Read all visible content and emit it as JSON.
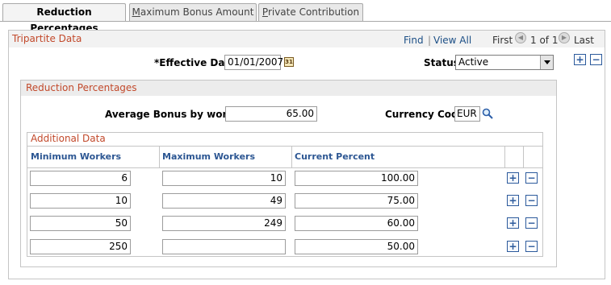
{
  "tabs": [
    {
      "label": "Reduction Percentages",
      "accel": ""
    },
    {
      "label": "aximum Bonus Amount",
      "accel": "M"
    },
    {
      "label": "rivate Contribution",
      "accel": "P"
    }
  ],
  "section": {
    "title": "Tripartite Data",
    "find": "Find",
    "separator": "|",
    "view_all": "View All",
    "first": "First",
    "count": "1 of 1",
    "last": "Last"
  },
  "effective_date": {
    "label": "*Effective Date",
    "value": "01/01/2007"
  },
  "status": {
    "label": "Status",
    "value": "Active"
  },
  "reduction": {
    "title": "Reduction Percentages",
    "avg_bonus_label": "Average Bonus by worker",
    "avg_bonus_value": "65.00",
    "currency_label": "Currency Code",
    "currency_value": "EUR"
  },
  "grid": {
    "title": "Additional Data",
    "columns": [
      "Minimum Workers",
      "Maximum Workers",
      "Current Percent"
    ],
    "rows": [
      {
        "min": "6",
        "max": "10",
        "pct": "100.00"
      },
      {
        "min": "10",
        "max": "49",
        "pct": "75.00"
      },
      {
        "min": "50",
        "max": "249",
        "pct": "60.00"
      },
      {
        "min": "250",
        "max": "",
        "pct": "50.00"
      }
    ]
  },
  "icons": {
    "add": "+",
    "remove": "−",
    "prev": "◀",
    "next": "▶",
    "calendar": "31"
  }
}
